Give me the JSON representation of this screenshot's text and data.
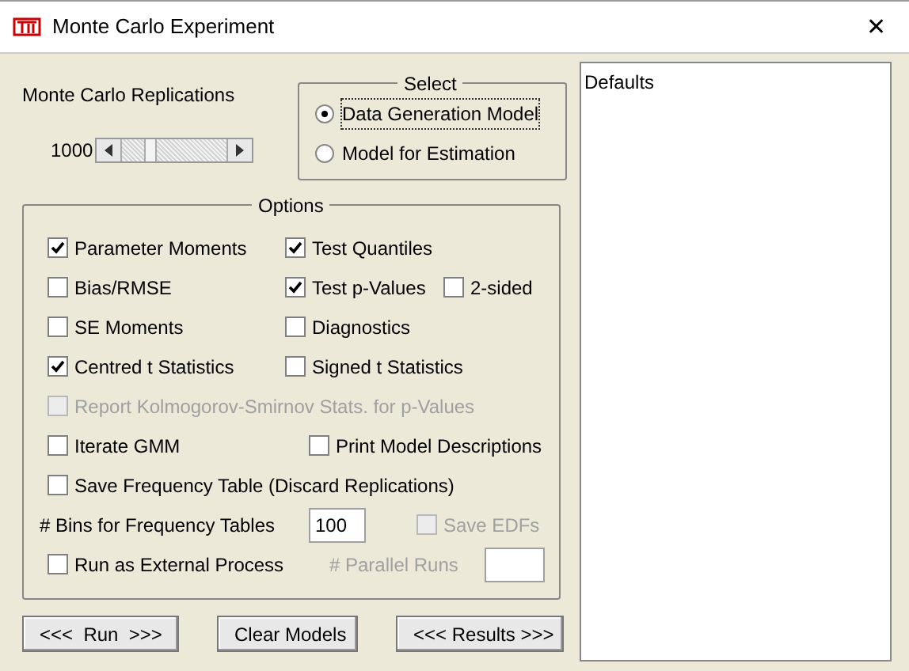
{
  "window": {
    "title": "Monte Carlo Experiment",
    "close": "✕"
  },
  "replications": {
    "label": "Monte Carlo Replications",
    "value": "1000",
    "level": 0.23
  },
  "select": {
    "title": "Select",
    "options": [
      {
        "label": "Data Generation Model",
        "selected": true
      },
      {
        "label": "Model for Estimation",
        "selected": false
      }
    ]
  },
  "options": {
    "title": "Options",
    "rows": [
      [
        {
          "kind": "checkbox",
          "label": "Parameter Moments",
          "checked": true,
          "disabled": false
        },
        {
          "kind": "checkbox",
          "label": "Test Quantiles",
          "checked": true,
          "disabled": false
        }
      ],
      [
        {
          "kind": "checkbox",
          "label": "Bias/RMSE",
          "checked": false,
          "disabled": false
        },
        {
          "kind": "checkbox",
          "label": "Test p-Values",
          "checked": true,
          "disabled": false
        },
        {
          "kind": "checkbox",
          "label": "2-sided",
          "checked": false,
          "disabled": false
        }
      ],
      [
        {
          "kind": "checkbox",
          "label": "SE Moments",
          "checked": false,
          "disabled": false
        },
        {
          "kind": "checkbox",
          "label": "Diagnostics",
          "checked": false,
          "disabled": false
        }
      ],
      [
        {
          "kind": "checkbox",
          "label": "Centred t Statistics",
          "checked": true,
          "disabled": false
        },
        {
          "kind": "checkbox",
          "label": "Signed t Statistics",
          "checked": false,
          "disabled": false
        }
      ],
      [
        {
          "kind": "checkbox",
          "label": "Report Kolmogorov-Smirnov Stats. for p-Values",
          "checked": false,
          "disabled": true
        }
      ],
      [
        {
          "kind": "checkbox",
          "label": "Iterate GMM",
          "checked": false,
          "disabled": false
        },
        {
          "kind": "checkbox",
          "label": "Print Model Descriptions",
          "checked": false,
          "disabled": false
        }
      ],
      [
        {
          "kind": "checkbox",
          "label": "Save Frequency Table (Discard Replications)",
          "checked": false,
          "disabled": false
        }
      ],
      [
        {
          "kind": "label",
          "label": "# Bins for Frequency Tables",
          "disabled": false
        },
        {
          "kind": "field",
          "value": "100",
          "disabled": false
        },
        {
          "kind": "checkbox",
          "label": "Save EDFs",
          "checked": false,
          "disabled": true
        }
      ],
      [
        {
          "kind": "checkbox",
          "label": "Run as External Process",
          "checked": false,
          "disabled": false
        },
        {
          "kind": "label",
          "label": "# Parallel Runs",
          "disabled": true
        },
        {
          "kind": "field",
          "disabled": true
        }
      ]
    ]
  },
  "buttons": [
    "<<<  Run  >>>",
    "Clear Models",
    "<<< Results >>>"
  ],
  "list": {
    "items": [
      "Defaults"
    ]
  }
}
